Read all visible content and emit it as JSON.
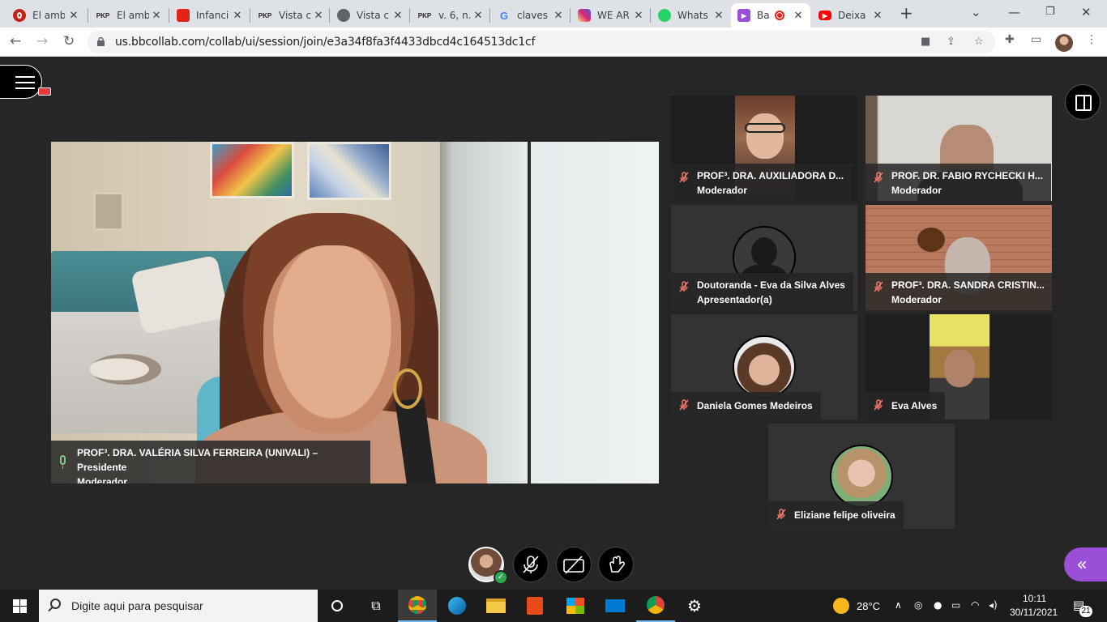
{
  "browser": {
    "tabs": [
      {
        "title": "El amb",
        "icon": "opera-red-icon",
        "color": "#c4211a",
        "active": false
      },
      {
        "title": "El amb",
        "icon": "pkp-icon",
        "color": "#222222",
        "active": false
      },
      {
        "title": "Infanci",
        "icon": "red-square-icon",
        "color": "#e2231a",
        "active": false
      },
      {
        "title": "Vista c",
        "icon": "pkp-icon",
        "color": "#222222",
        "active": false
      },
      {
        "title": "Vista c",
        "icon": "globe-icon",
        "color": "#5f6368",
        "active": false
      },
      {
        "title": "v. 6, n.",
        "icon": "pkp-icon",
        "color": "#222222",
        "active": false
      },
      {
        "title": "claves",
        "icon": "google-icon",
        "color": "#4285f4",
        "active": false
      },
      {
        "title": "WE AR",
        "icon": "instagram-icon",
        "color": "#d62976",
        "active": false
      },
      {
        "title": "Whats",
        "icon": "whatsapp-icon",
        "color": "#25d366",
        "active": false
      },
      {
        "title": "Ba",
        "icon": "blackboard-icon",
        "color": "#9b4ed8",
        "active": true
      },
      {
        "title": "Deixa",
        "icon": "youtube-icon",
        "color": "#ff0000",
        "active": false
      }
    ],
    "pkp_text": "PKP",
    "new_tab": "+",
    "minimize": "⌄",
    "url": "us.bbcollab.com/collab/ui/session/join/e3a34f8fa3f4433dbcd4c164513dc1cf"
  },
  "session": {
    "main_speaker": {
      "name": "PROF³. DRA. VALÉRIA SILVA FERREIRA (UNIVALI) – Presidente",
      "role": "Moderador"
    },
    "participants": [
      {
        "name": "PROF³. DRA. AUXILIADORA D...",
        "role": "Moderador"
      },
      {
        "name": "PROF. DR. FABIO RYCHECKI H...",
        "role": "Moderador"
      },
      {
        "name": "Doutoranda - Eva da Silva Alves",
        "role": "Apresentador(a)"
      },
      {
        "name": "PROF³. DRA. SANDRA CRISTIN...",
        "role": "Moderador"
      },
      {
        "name": "Daniela Gomes Medeiros",
        "role": ""
      },
      {
        "name": "Eva Alves",
        "role": ""
      },
      {
        "name": "Eliziane felipe oliveira",
        "role": ""
      }
    ],
    "accent_color": "#9b4ed8"
  },
  "taskbar": {
    "search_placeholder": "Digite aqui para pesquisar",
    "temperature": "28°C",
    "time": "10:11",
    "date": "30/11/2021",
    "notifications": "21"
  }
}
